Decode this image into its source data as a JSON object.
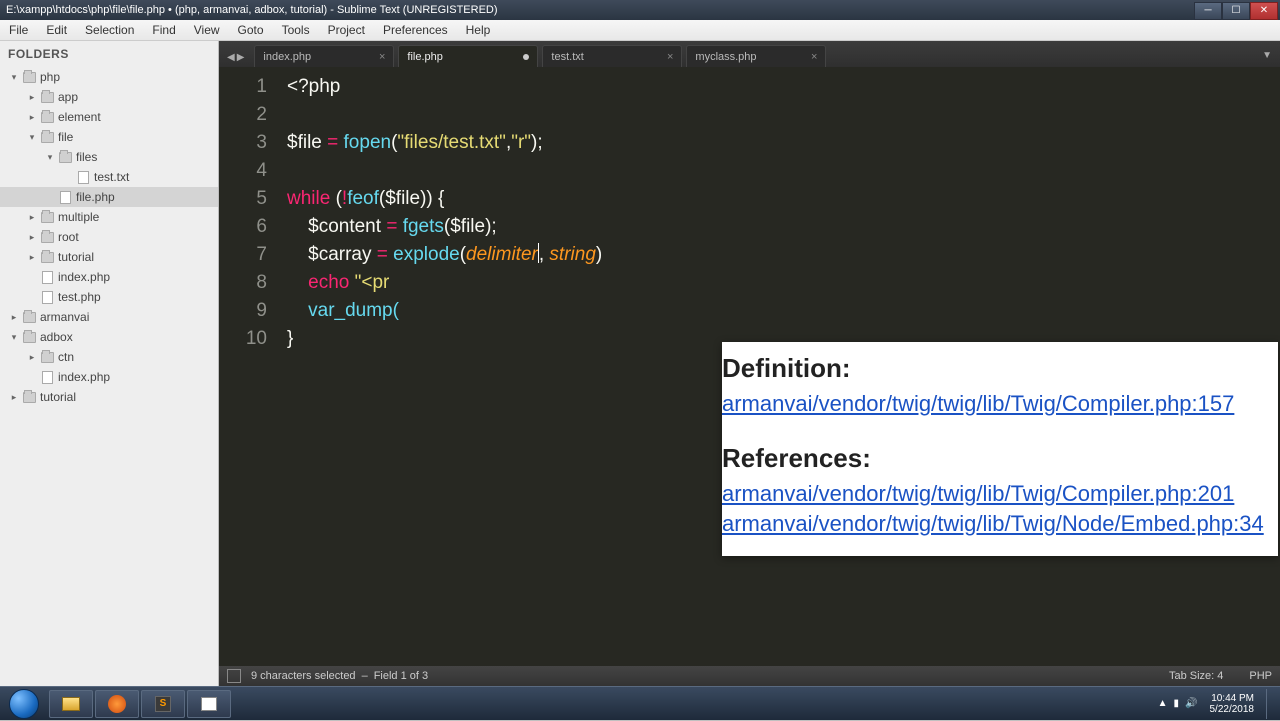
{
  "window": {
    "title": "E:\\xampp\\htdocs\\php\\file\\file.php • (php, armanvai, adbox, tutorial) - Sublime Text (UNREGISTERED)"
  },
  "menu": [
    "File",
    "Edit",
    "Selection",
    "Find",
    "View",
    "Goto",
    "Tools",
    "Project",
    "Preferences",
    "Help"
  ],
  "sidebar": {
    "header": "FOLDERS",
    "tree": [
      {
        "indent": 0,
        "arrow": "▾",
        "type": "folder",
        "label": "php"
      },
      {
        "indent": 1,
        "arrow": "▸",
        "type": "folder",
        "label": "app"
      },
      {
        "indent": 1,
        "arrow": "▸",
        "type": "folder",
        "label": "element"
      },
      {
        "indent": 1,
        "arrow": "▾",
        "type": "folder",
        "label": "file"
      },
      {
        "indent": 2,
        "arrow": "▾",
        "type": "folder",
        "label": "files"
      },
      {
        "indent": 3,
        "arrow": "",
        "type": "file",
        "label": "test.txt"
      },
      {
        "indent": 2,
        "arrow": "",
        "type": "file",
        "label": "file.php",
        "selected": true
      },
      {
        "indent": 1,
        "arrow": "▸",
        "type": "folder",
        "label": "multiple"
      },
      {
        "indent": 1,
        "arrow": "▸",
        "type": "folder",
        "label": "root"
      },
      {
        "indent": 1,
        "arrow": "▸",
        "type": "folder",
        "label": "tutorial"
      },
      {
        "indent": 1,
        "arrow": "",
        "type": "file",
        "label": "index.php"
      },
      {
        "indent": 1,
        "arrow": "",
        "type": "file",
        "label": "test.php"
      },
      {
        "indent": 0,
        "arrow": "▸",
        "type": "folder",
        "label": "armanvai"
      },
      {
        "indent": 0,
        "arrow": "▾",
        "type": "folder",
        "label": "adbox"
      },
      {
        "indent": 1,
        "arrow": "▸",
        "type": "folder",
        "label": "ctn"
      },
      {
        "indent": 1,
        "arrow": "",
        "type": "file",
        "label": "index.php"
      },
      {
        "indent": 0,
        "arrow": "▸",
        "type": "folder",
        "label": "tutorial"
      }
    ]
  },
  "tabs": [
    {
      "label": "index.php",
      "active": false,
      "dirty": false
    },
    {
      "label": "file.php",
      "active": true,
      "dirty": true
    },
    {
      "label": "test.txt",
      "active": false,
      "dirty": false
    },
    {
      "label": "myclass.php",
      "active": false,
      "dirty": false
    }
  ],
  "code": {
    "line_numbers": [
      "1",
      "2",
      "3",
      "4",
      "5",
      "6",
      "7",
      "8",
      "9",
      "10"
    ],
    "l1_open": "<?php",
    "l3_var": "$file",
    "l3_fn": "fopen",
    "l3_s1": "\"files/test.txt\"",
    "l3_s2": "\"r\"",
    "l5_kw": "while",
    "l5_not": "!",
    "l5_fn": "feof",
    "l5_var": "$file",
    "l6_var": "$content",
    "l6_fn": "fgets",
    "l6_arg": "$file",
    "l7_var": "$carray",
    "l7_fn": "explode",
    "l7_p1": "delimiter",
    "l7_p2": "string",
    "l8_kw": "echo",
    "l8_s": "\"<pr",
    "l9_fn": "var_dump("
  },
  "popup": {
    "def_h": "Definition:",
    "def_link": "armanvai/vendor/twig/twig/lib/Twig/Compiler.php:157",
    "ref_h": "References:",
    "ref1": "armanvai/vendor/twig/twig/lib/Twig/Compiler.php:201",
    "ref2": "armanvai/vendor/twig/twig/lib/Twig/Node/Embed.php:34"
  },
  "status": {
    "selection": "9 characters selected",
    "field": "Field 1 of 3",
    "tabsize": "Tab Size: 4",
    "lang": "PHP"
  },
  "tray": {
    "time": "10:44 PM",
    "date": "5/22/2018"
  }
}
